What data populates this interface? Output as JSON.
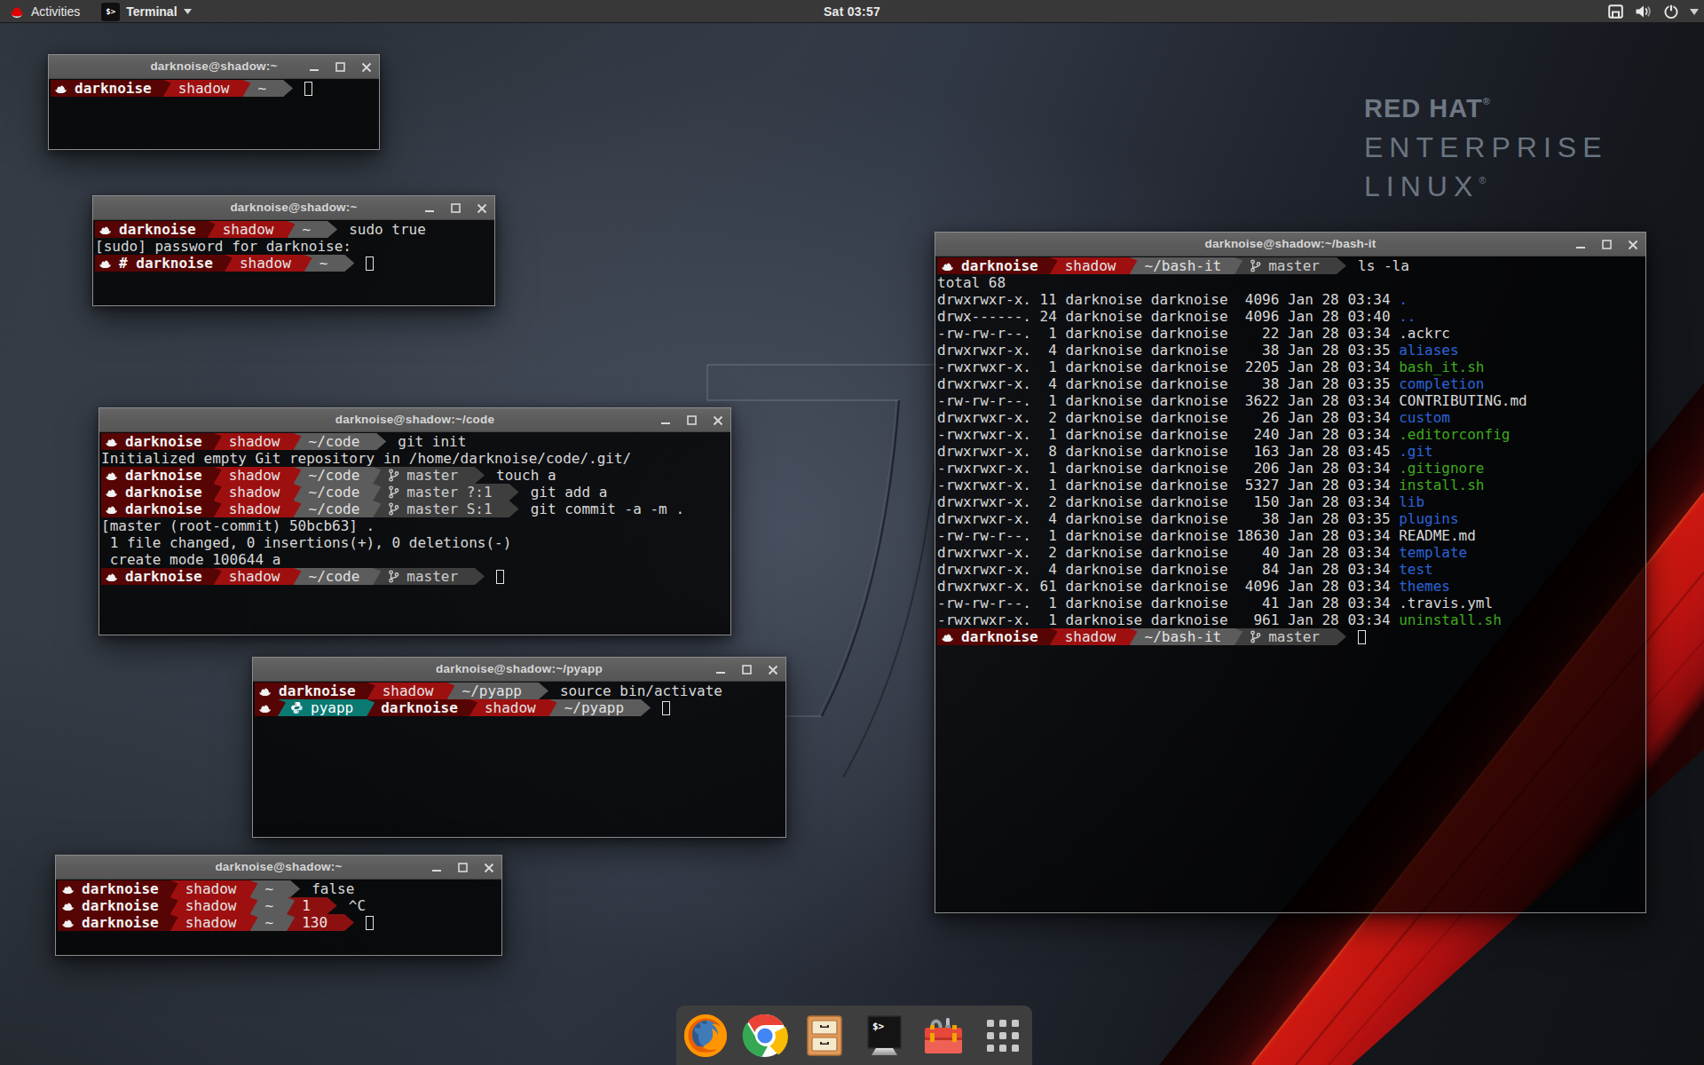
{
  "topbar": {
    "activities_label": "Activities",
    "app_label": "Terminal",
    "app_icon_text": "$>",
    "clock": "Sat 03:57",
    "right_icons": [
      "network-icon",
      "volume-icon",
      "power-icon",
      "chevron-down-icon"
    ]
  },
  "wallpaper": {
    "logo_line1": "RED HAT",
    "logo_line2": "ENTERPRISE",
    "logo_line3": "LINUX",
    "registered_mark": "®",
    "ribbon_color": "#c41511"
  },
  "dock": {
    "items": [
      {
        "name": "firefox",
        "label": "Firefox"
      },
      {
        "name": "chrome",
        "label": "Google Chrome"
      },
      {
        "name": "files",
        "label": "Files"
      },
      {
        "name": "terminal",
        "label": "Terminal"
      },
      {
        "name": "toolbox",
        "label": "Toolbox"
      },
      {
        "name": "appgrid",
        "label": "Show Applications"
      }
    ]
  },
  "colors": {
    "segment_user": "#570404",
    "segment_host": "#9e1010",
    "segment_path": "#5c5c5c",
    "segment_git": "#3e3e3e",
    "segment_error": "#8c1010",
    "segment_venv": "#0a7a73",
    "ls_directory": "#2c63d8",
    "ls_executable": "#3faa1e",
    "terminal_text": "#d8d8d8"
  },
  "windows": [
    {
      "id": "w1",
      "title": "darknoise@shadow:~",
      "buttons": [
        "minimize",
        "maximize",
        "close"
      ],
      "lines": [
        {
          "t": "p",
          "user": "darknoise",
          "host": "shadow",
          "path": "~",
          "cursor": true
        }
      ]
    },
    {
      "id": "w2",
      "title": "darknoise@shadow:~",
      "buttons": [
        "minimize",
        "maximize",
        "close"
      ],
      "lines": [
        {
          "t": "p",
          "user": "darknoise",
          "host": "shadow",
          "path": "~",
          "cmd": "sudo true"
        },
        {
          "t": "x",
          "text": "[sudo] password for darknoise:"
        },
        {
          "t": "p",
          "user": "# darknoise",
          "host": "shadow",
          "path": "~",
          "cursor": true
        }
      ]
    },
    {
      "id": "w3",
      "title": "darknoise@shadow:~/code",
      "buttons": [
        "minimize",
        "maximize",
        "close"
      ],
      "lines": [
        {
          "t": "p",
          "user": "darknoise",
          "host": "shadow",
          "path": "~/code",
          "cmd": "git init"
        },
        {
          "t": "x",
          "text": "Initialized empty Git repository in /home/darknoise/code/.git/"
        },
        {
          "t": "p",
          "user": "darknoise",
          "host": "shadow",
          "path": "~/code",
          "git": "master",
          "cmd": "touch a"
        },
        {
          "t": "p",
          "user": "darknoise",
          "host": "shadow",
          "path": "~/code",
          "git": "master ?:1",
          "cmd": "git add a"
        },
        {
          "t": "p",
          "user": "darknoise",
          "host": "shadow",
          "path": "~/code",
          "git": "master S:1",
          "cmd": "git commit -a -m ."
        },
        {
          "t": "x",
          "text": "[master (root-commit) 50bcb63] ."
        },
        {
          "t": "x",
          "text": " 1 file changed, 0 insertions(+), 0 deletions(-)"
        },
        {
          "t": "x",
          "text": " create mode 100644 a"
        },
        {
          "t": "p",
          "user": "darknoise",
          "host": "shadow",
          "path": "~/code",
          "git": "master",
          "cursor": true
        }
      ]
    },
    {
      "id": "w4",
      "title": "darknoise@shadow:~/pyapp",
      "buttons": [
        "minimize",
        "maximize",
        "close"
      ],
      "lines": [
        {
          "t": "p",
          "user": "darknoise",
          "host": "shadow",
          "path": "~/pyapp",
          "cmd": "source bin/activate"
        },
        {
          "t": "p",
          "venv": "pyapp",
          "user": "darknoise",
          "host": "shadow",
          "path": "~/pyapp",
          "cursor": true
        }
      ]
    },
    {
      "id": "w5",
      "title": "darknoise@shadow:~",
      "buttons": [
        "minimize",
        "maximize",
        "close"
      ],
      "lines": [
        {
          "t": "p",
          "user": "darknoise",
          "host": "shadow",
          "path": "~",
          "cmd": "false"
        },
        {
          "t": "p",
          "user": "darknoise",
          "host": "shadow",
          "path": "~",
          "err": "1",
          "cmd": "^C"
        },
        {
          "t": "p",
          "user": "darknoise",
          "host": "shadow",
          "path": "~",
          "err": "130",
          "cursor": true
        }
      ]
    },
    {
      "id": "w6",
      "title": "darknoise@shadow:~/bash-it",
      "buttons": [
        "minimize",
        "maximize",
        "close"
      ],
      "lines": [
        {
          "t": "p",
          "user": "darknoise",
          "host": "shadow",
          "path": "~/bash-it",
          "git": "master",
          "cmd": "ls -la"
        },
        {
          "t": "x",
          "text": "total 68"
        },
        {
          "t": "ls",
          "pre": "drwxrwxr-x. 11 darknoise darknoise  4096 Jan 28 03:34 ",
          "name": ".",
          "kind": "dir"
        },
        {
          "t": "ls",
          "pre": "drwx------. 24 darknoise darknoise  4096 Jan 28 03:40 ",
          "name": "..",
          "kind": "dir"
        },
        {
          "t": "ls",
          "pre": "-rw-rw-r--.  1 darknoise darknoise    22 Jan 28 03:34 ",
          "name": ".ackrc",
          "kind": "file"
        },
        {
          "t": "ls",
          "pre": "drwxrwxr-x.  4 darknoise darknoise    38 Jan 28 03:35 ",
          "name": "aliases",
          "kind": "dir"
        },
        {
          "t": "ls",
          "pre": "-rwxrwxr-x.  1 darknoise darknoise  2205 Jan 28 03:34 ",
          "name": "bash_it.sh",
          "kind": "exec"
        },
        {
          "t": "ls",
          "pre": "drwxrwxr-x.  4 darknoise darknoise    38 Jan 28 03:35 ",
          "name": "completion",
          "kind": "dir"
        },
        {
          "t": "ls",
          "pre": "-rw-rw-r--.  1 darknoise darknoise  3622 Jan 28 03:34 ",
          "name": "CONTRIBUTING.md",
          "kind": "file"
        },
        {
          "t": "ls",
          "pre": "drwxrwxr-x.  2 darknoise darknoise    26 Jan 28 03:34 ",
          "name": "custom",
          "kind": "dir"
        },
        {
          "t": "ls",
          "pre": "-rwxrwxr-x.  1 darknoise darknoise   240 Jan 28 03:34 ",
          "name": ".editorconfig",
          "kind": "exec"
        },
        {
          "t": "ls",
          "pre": "drwxrwxr-x.  8 darknoise darknoise   163 Jan 28 03:45 ",
          "name": ".git",
          "kind": "dir"
        },
        {
          "t": "ls",
          "pre": "-rwxrwxr-x.  1 darknoise darknoise   206 Jan 28 03:34 ",
          "name": ".gitignore",
          "kind": "exec"
        },
        {
          "t": "ls",
          "pre": "-rwxrwxr-x.  1 darknoise darknoise  5327 Jan 28 03:34 ",
          "name": "install.sh",
          "kind": "exec"
        },
        {
          "t": "ls",
          "pre": "drwxrwxr-x.  2 darknoise darknoise   150 Jan 28 03:34 ",
          "name": "lib",
          "kind": "dir"
        },
        {
          "t": "ls",
          "pre": "drwxrwxr-x.  4 darknoise darknoise    38 Jan 28 03:35 ",
          "name": "plugins",
          "kind": "dir"
        },
        {
          "t": "ls",
          "pre": "-rw-rw-r--.  1 darknoise darknoise 18630 Jan 28 03:34 ",
          "name": "README.md",
          "kind": "file"
        },
        {
          "t": "ls",
          "pre": "drwxrwxr-x.  2 darknoise darknoise    40 Jan 28 03:34 ",
          "name": "template",
          "kind": "dir"
        },
        {
          "t": "ls",
          "pre": "drwxrwxr-x.  4 darknoise darknoise    84 Jan 28 03:34 ",
          "name": "test",
          "kind": "dir"
        },
        {
          "t": "ls",
          "pre": "drwxrwxr-x. 61 darknoise darknoise  4096 Jan 28 03:34 ",
          "name": "themes",
          "kind": "dir"
        },
        {
          "t": "ls",
          "pre": "-rw-rw-r--.  1 darknoise darknoise    41 Jan 28 03:34 ",
          "name": ".travis.yml",
          "kind": "file"
        },
        {
          "t": "ls",
          "pre": "-rwxrwxr-x.  1 darknoise darknoise   961 Jan 28 03:34 ",
          "name": "uninstall.sh",
          "kind": "exec"
        },
        {
          "t": "p",
          "user": "darknoise",
          "host": "shadow",
          "path": "~/bash-it",
          "git": "master",
          "cursor": true
        }
      ]
    }
  ]
}
